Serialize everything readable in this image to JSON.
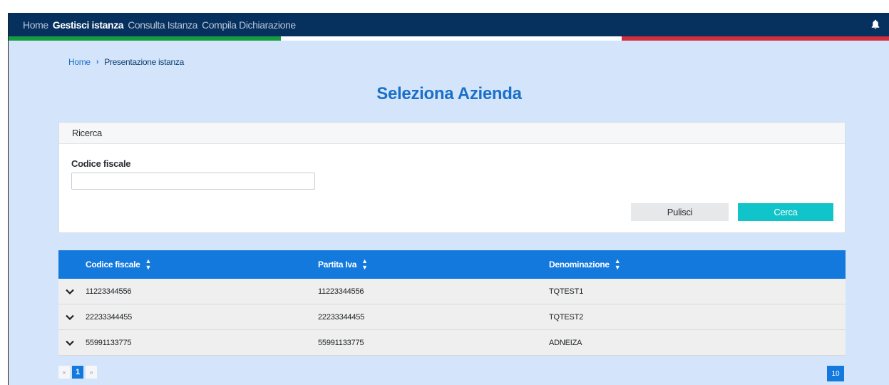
{
  "nav": {
    "items": [
      {
        "label": "Home"
      },
      {
        "label": "Gestisci istanza"
      },
      {
        "label": "Consulta Istanza"
      },
      {
        "label": "Compila Dichiarazione"
      }
    ],
    "icons": {
      "notifications": "bell-icon"
    }
  },
  "breadcrumb": {
    "home": "Home",
    "separator": "›",
    "current": "Presentazione istanza"
  },
  "page": {
    "title": "Seleziona Azienda"
  },
  "search": {
    "header": "Ricerca",
    "codice_fiscale_label": "Codice fiscale",
    "codice_fiscale_value": "",
    "clear_label": "Pulisci",
    "search_label": "Cerca"
  },
  "table": {
    "columns": [
      {
        "label": "Codice fiscale"
      },
      {
        "label": "Partita Iva"
      },
      {
        "label": "Denominazione"
      }
    ],
    "rows": [
      {
        "codice_fiscale": "11223344556",
        "partita_iva": "11223344556",
        "denominazione": "TQTEST1"
      },
      {
        "codice_fiscale": "22233344455",
        "partita_iva": "22233344455",
        "denominazione": "TQTEST2"
      },
      {
        "codice_fiscale": "55991133775",
        "partita_iva": "55991133775",
        "denominazione": "ADNEIZA"
      }
    ]
  },
  "pagination": {
    "prev": "«",
    "current_page": "1",
    "next": "»",
    "page_size": "10"
  },
  "colors": {
    "topbar": "#06305e",
    "background": "#d4e5fb",
    "accent": "#1479dd",
    "cerca_button": "#11c4c9",
    "flag_green": "#149c3f",
    "flag_white": "#ffffff",
    "flag_red": "#d0303b"
  }
}
